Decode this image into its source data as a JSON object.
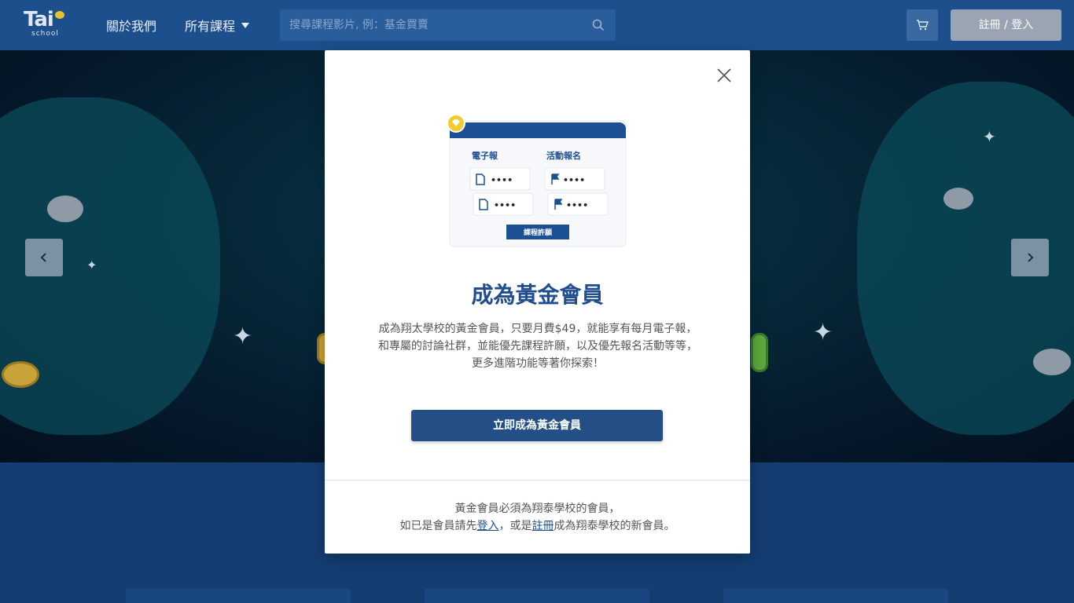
{
  "header": {
    "logo_text": "Tai",
    "logo_sub": "school",
    "nav_about": "關於我們",
    "nav_courses": "所有課程",
    "search_placeholder": "搜尋課程影片, 例：基金買賣",
    "auth_label": "註冊 / 登入"
  },
  "modal": {
    "illustration": {
      "col1_title": "電子報",
      "col2_title": "活動報名",
      "chip_text": "••••",
      "button_text": "課程許願"
    },
    "title": "成為黃金會員",
    "description": "成為翔太學校的黃金會員，只要月費$49，就能享有每月電子報，和專屬的討論社群，並能優先課程許願，以及優先報名活動等等，更多進階功能等著你探索！",
    "cta_label": "立即成為黃金會員",
    "footer_line1": "黃金會員必須為翔泰學校的會員，",
    "footer_prefix": "如已是會員請先",
    "login_link": "登入",
    "footer_middle": "，或是",
    "register_link": "註冊",
    "footer_suffix": "成為翔泰學校的新會員。"
  },
  "icons": {
    "search": "search-icon",
    "cart": "cart-icon",
    "close": "close-icon",
    "prev": "chevron-left-icon",
    "next": "chevron-right-icon"
  },
  "colors": {
    "header_bg": "#1d4f8c",
    "page_bg": "#143d72",
    "primary": "#234f86",
    "title": "#1f4d8e",
    "gold": "#f2cc2e"
  }
}
